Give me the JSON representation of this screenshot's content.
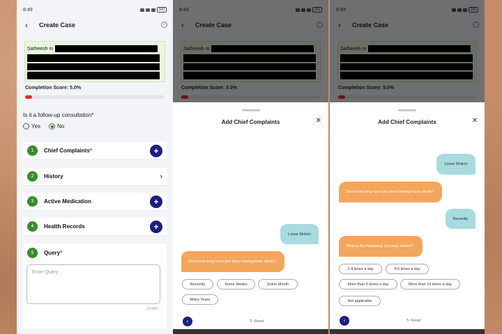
{
  "status": {
    "time": "8:49",
    "battery": "100"
  },
  "appbar": {
    "title": "Create Case",
    "back_icon": "‹",
    "info_icon": "ⓘ"
  },
  "patient": {
    "name": "Satheesh m"
  },
  "completion": {
    "label": "Completion Score: 5.0%",
    "progress_fraction": 0.05
  },
  "followup": {
    "question": "Is it a follow-up consultation*",
    "options": [
      "Yes",
      "No"
    ],
    "selected": "No"
  },
  "sections": [
    {
      "number": "1",
      "label": "Chief Complaints",
      "required": "*",
      "action": "+"
    },
    {
      "number": "2",
      "label": "History",
      "required": "",
      "action": "›"
    },
    {
      "number": "3",
      "label": "Active Medication",
      "required": "",
      "action": "+"
    },
    {
      "number": "4",
      "label": "Health Records",
      "required": "",
      "action": "+"
    },
    {
      "number": "5",
      "label": "Query",
      "required": "*",
      "action": ""
    }
  ],
  "query": {
    "placeholder": "Enter Query",
    "counter": "0/1500"
  },
  "sheet": {
    "title": "Add Chief Complaints",
    "close_icon": "✕",
    "reset_label": "Reset",
    "reset_icon": "↻",
    "back_icon": "‹"
  },
  "chat1": {
    "user_1": "Loose Motion",
    "bot_1": "Since how long have you been having loose stools?",
    "chips": [
      "Recently",
      "Some Weeks",
      "Some Month",
      "Many Years"
    ]
  },
  "chat2": {
    "user_1": "Loose Motion",
    "bot_1": "Since how long have you been having loose stools?",
    "user_2": "Recently",
    "bot_2": "What is the frequency of Loose motion?",
    "chips": [
      "2-4 times a day",
      "4-6 times a day",
      "More than 6 times a day",
      "More than 10 times a day",
      "Not applicable"
    ]
  },
  "colors": {
    "primary": "#1a1e84",
    "success": "#3a8a2c",
    "danger": "#e0302f",
    "user_bubble": "#a8dbe0",
    "bot_bubble": "#f3a65c"
  }
}
